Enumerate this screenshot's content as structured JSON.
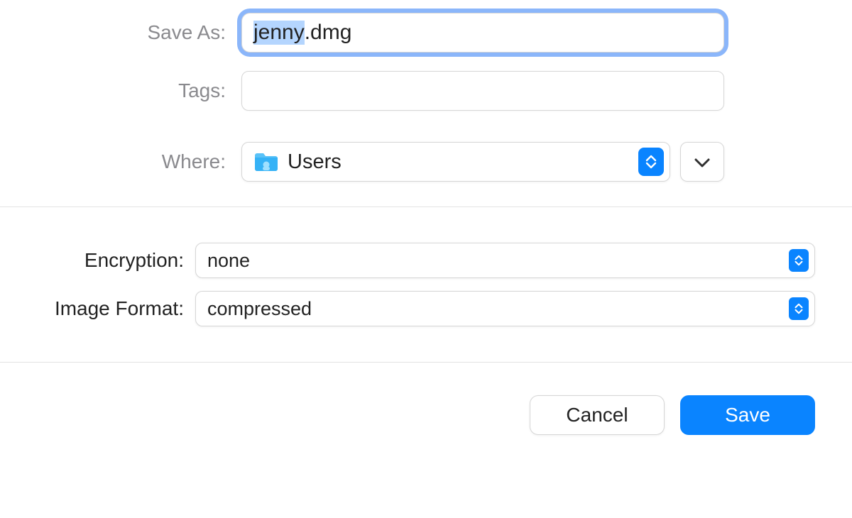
{
  "labels": {
    "save_as": "Save As:",
    "tags": "Tags:",
    "where": "Where:",
    "encryption": "Encryption:",
    "image_format": "Image Format:"
  },
  "save_as": {
    "selected_portion": "jenny",
    "unselected_portion": ".dmg",
    "full_value": "jenny.dmg"
  },
  "tags": {
    "value": ""
  },
  "where": {
    "value": "Users"
  },
  "encryption": {
    "value": "none"
  },
  "image_format": {
    "value": "compressed"
  },
  "buttons": {
    "cancel": "Cancel",
    "save": "Save"
  },
  "colors": {
    "accent": "#0a84ff",
    "focus_ring": "rgba(62,133,247,0.6)",
    "label_muted": "#8a8a8e"
  }
}
